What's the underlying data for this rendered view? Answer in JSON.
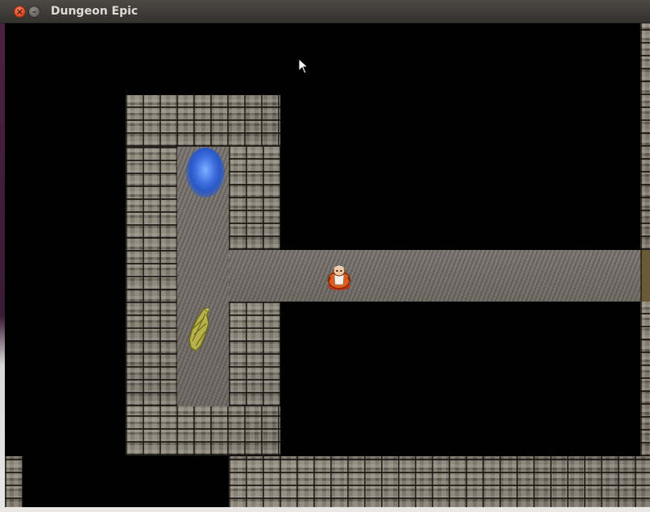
{
  "window": {
    "title": "Dungeon Epic",
    "close_symbol": "×",
    "minimize_symbol": "–"
  },
  "colors": {
    "background": "#000000",
    "titlebar": "#3c3b37",
    "title_text": "#dfdbd2",
    "close_button": "#e2502a"
  },
  "sprites": {
    "player": "player-character",
    "portal": "blue-portal",
    "item": "seashell-relic"
  },
  "icons": [
    "close-icon",
    "minimize-icon",
    "mouse-pointer-icon"
  ]
}
